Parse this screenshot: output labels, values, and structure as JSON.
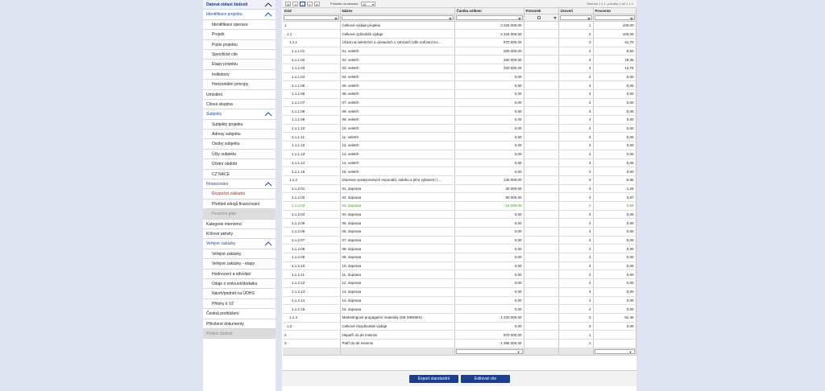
{
  "sidebar": {
    "header": "Datová oblast žádosti",
    "sections": [
      {
        "label": "Identifikace projektu",
        "type": "section",
        "collapsible": true
      },
      {
        "label": "Identifikace operace",
        "type": "sub"
      },
      {
        "label": "Projekt",
        "type": "sub"
      },
      {
        "label": "Popis projektu",
        "type": "sub"
      },
      {
        "label": "Specifické cíle",
        "type": "sub"
      },
      {
        "label": "Etapy projektu",
        "type": "sub"
      },
      {
        "label": "Indikátory",
        "type": "sub"
      },
      {
        "label": "Horizontální principy",
        "type": "sub"
      },
      {
        "label": "Umístění",
        "type": "top"
      },
      {
        "label": "Cílová skupina",
        "type": "top"
      },
      {
        "label": "Subjekty",
        "type": "section",
        "collapsible": true
      },
      {
        "label": "Subjekty projektu",
        "type": "sub"
      },
      {
        "label": "Adresy subjektu",
        "type": "sub"
      },
      {
        "label": "Osoby subjektu",
        "type": "sub"
      },
      {
        "label": "Účty subjektu",
        "type": "sub"
      },
      {
        "label": "Účetní období",
        "type": "sub"
      },
      {
        "label": "CZ NACE",
        "type": "sub"
      },
      {
        "label": "Financování",
        "type": "section",
        "collapsible": true
      },
      {
        "label": "Rozpočet základní",
        "type": "sub",
        "active": true
      },
      {
        "label": "Přehled zdrojů financování",
        "type": "sub"
      },
      {
        "label": "Finanční plán",
        "type": "sub",
        "disabled": true
      },
      {
        "label": "Kategorie intervencí",
        "type": "top"
      },
      {
        "label": "Klíčové aktivity",
        "type": "top"
      },
      {
        "label": "Veřejné zakázky",
        "type": "section",
        "collapsible": true
      },
      {
        "label": "Veřejné zakázky",
        "type": "sub"
      },
      {
        "label": "Veřejné zakázky - etapy",
        "type": "sub"
      },
      {
        "label": "Hodnocení a odvolání",
        "type": "sub"
      },
      {
        "label": "Údaje o smlouvě/dodatku",
        "type": "sub"
      },
      {
        "label": "Návrh/podnět na ÚOHS",
        "type": "sub"
      },
      {
        "label": "Přílohy k VZ",
        "type": "sub"
      },
      {
        "label": "Čestná prohlášení",
        "type": "top"
      },
      {
        "label": "Přiložené dokumenty",
        "type": "top"
      },
      {
        "label": "Podpis žádosti",
        "type": "top",
        "disabled": true
      }
    ]
  },
  "pager": {
    "current_page": "1",
    "page_size_label": "Položek na stránku:",
    "page_size": "25",
    "info": "Stránka 1 z 1, položky 1 až 1 z 1"
  },
  "table": {
    "columns": [
      "Kód",
      "Název",
      "Částka celkem",
      "Potomek",
      "Úroveň",
      "Procento"
    ],
    "rows": [
      [
        "1",
        "Celkové výdaje projektu",
        "2 326 000,00",
        "",
        "1",
        "100,00"
      ],
      [
        "1.1",
        "Celkové způsobilé výdaje",
        "2 326 000,00",
        "",
        "2",
        "100,00"
      ],
      [
        "1.1.1",
        "Účast na veletrzích a výstavách v zahraničí (dle nařízení Ko...",
        "970 000,00",
        "",
        "3",
        "41,70"
      ],
      [
        "1.1.1.01",
        "01. veletrh",
        "200 000,00",
        "",
        "4",
        "8,60"
      ],
      [
        "1.1.1.02",
        "02. veletrh",
        "450 000,00",
        "",
        "4",
        "19,35"
      ],
      [
        "1.1.1.03",
        "03. veletrh",
        "320 000,00",
        "",
        "4",
        "13,76"
      ],
      [
        "1.1.1.04",
        "04. veletrh",
        "0,00",
        "",
        "4",
        "0,00"
      ],
      [
        "1.1.1.05",
        "05. veletrh",
        "0,00",
        "",
        "4",
        "0,00"
      ],
      [
        "1.1.1.06",
        "06. veletrh",
        "0,00",
        "",
        "4",
        "0,00"
      ],
      [
        "1.1.1.07",
        "07. veletrh",
        "0,00",
        "",
        "4",
        "0,00"
      ],
      [
        "1.1.1.08",
        "08. veletrh",
        "0,00",
        "",
        "4",
        "0,00"
      ],
      [
        "1.1.1.09",
        "09. veletrh",
        "0,00",
        "",
        "4",
        "0,00"
      ],
      [
        "1.1.1.10",
        "10. veletrh",
        "0,00",
        "",
        "4",
        "0,00"
      ],
      [
        "1.1.1.11",
        "11. veletrh",
        "0,00",
        "",
        "4",
        "0,00"
      ],
      [
        "1.1.1.12",
        "12. veletrh",
        "0,00",
        "",
        "4",
        "0,00"
      ],
      [
        "1.1.1.13",
        "13. veletrh",
        "0,00",
        "",
        "4",
        "0,00"
      ],
      [
        "1.1.1.14",
        "14. veletrh",
        "0,00",
        "",
        "4",
        "0,00"
      ],
      [
        "1.1.1.15",
        "15. veletrh",
        "0,00",
        "",
        "4",
        "0,00"
      ],
      [
        "1.1.2",
        "Doprava vystavovaných exponátů, stánku a jeho vybavení (...",
        "136 000,00",
        "",
        "3",
        "5,85"
      ],
      [
        "1.1.2.01",
        "01. doprava",
        "30 000,00",
        "",
        "4",
        "1,29"
      ],
      [
        "1.1.2.02",
        "02. doprava",
        "90 000,00",
        "",
        "4",
        "3,87"
      ],
      [
        "1.1.2.03",
        "03. doprava",
        "16 000,00",
        "",
        "4",
        "0,69"
      ],
      [
        "1.1.2.04",
        "04. doprava",
        "0,00",
        "",
        "4",
        "0,00"
      ],
      [
        "1.1.2.05",
        "05. doprava",
        "0,00",
        "",
        "4",
        "0,00"
      ],
      [
        "1.1.2.06",
        "06. doprava",
        "0,00",
        "",
        "4",
        "0,00"
      ],
      [
        "1.1.2.07",
        "07. doprava",
        "0,00",
        "",
        "4",
        "0,00"
      ],
      [
        "1.1.2.08",
        "08. doprava",
        "0,00",
        "",
        "4",
        "0,00"
      ],
      [
        "1.1.2.09",
        "09. doprava",
        "0,00",
        "",
        "4",
        "0,00"
      ],
      [
        "1.1.2.10",
        "10. doprava",
        "0,00",
        "",
        "4",
        "0,00"
      ],
      [
        "1.1.2.11",
        "11. doprava",
        "0,00",
        "",
        "4",
        "0,00"
      ],
      [
        "1.1.2.12",
        "12. doprava",
        "0,00",
        "",
        "4",
        "0,00"
      ],
      [
        "1.1.2.13",
        "13. doprava",
        "0,00",
        "",
        "4",
        "0,00"
      ],
      [
        "1.1.2.14",
        "14. doprava",
        "0,00",
        "",
        "4",
        "0,00"
      ],
      [
        "1.1.2.15",
        "15. doprava",
        "0,00",
        "",
        "4",
        "0,00"
      ],
      [
        "1.1.3",
        "Marketingové propagační materiály (DE MINIMIS)",
        "1 220 000,00",
        "",
        "3",
        "52,45"
      ],
      [
        "1.2",
        "Celkové nezpůsobilé výdaje",
        "0,00",
        "",
        "3",
        "0,00"
      ],
      [
        "2",
        "Nepatří do de minimis",
        "970 000,00",
        "",
        "1",
        ""
      ],
      [
        "3",
        "Patří do de minimis",
        "1 356 000,00",
        "",
        "1",
        ""
      ]
    ],
    "indent": [
      0,
      1,
      2,
      3,
      3,
      3,
      3,
      3,
      3,
      3,
      3,
      3,
      3,
      3,
      3,
      3,
      3,
      3,
      2,
      3,
      3,
      3,
      3,
      3,
      3,
      3,
      3,
      3,
      3,
      3,
      3,
      3,
      3,
      3,
      2,
      1,
      0,
      0
    ],
    "highlight_row": 21,
    "highlight_color": "#3a9a17"
  },
  "buttons": {
    "export": "Export standardní",
    "edit_all": "Editovat vše"
  },
  "colors": {
    "accent": "#1b3e8f",
    "section_text": "#1f4fa0",
    "active_red": "#d01818",
    "background": "#dde3ef"
  }
}
